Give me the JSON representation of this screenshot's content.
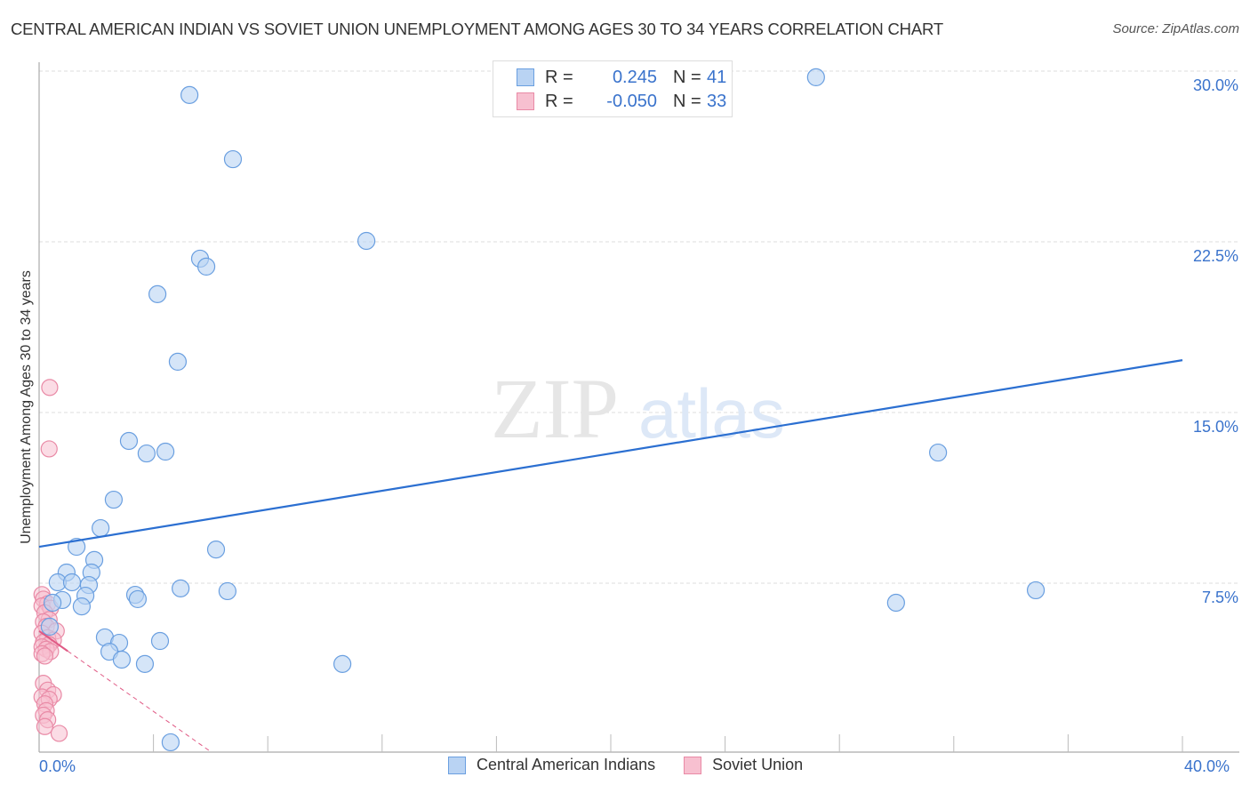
{
  "title": "CENTRAL AMERICAN INDIAN VS SOVIET UNION UNEMPLOYMENT AMONG AGES 30 TO 34 YEARS CORRELATION CHART",
  "source": "Source: ZipAtlas.com",
  "watermark": {
    "zip": "ZIP",
    "atlas": "atlas"
  },
  "colors": {
    "blue_fill": "#b9d3f3",
    "blue_stroke": "#6a9fe0",
    "blue_line": "#2b6fd1",
    "pink_fill": "#f7c0d0",
    "pink_stroke": "#e98aa6",
    "pink_line": "#e05a85",
    "tick_label": "#3a73cc"
  },
  "legend": {
    "rows": [
      {
        "r_label": "R =",
        "r_value": "0.245",
        "n_label": "N =",
        "n_value": "41"
      },
      {
        "r_label": "R =",
        "r_value": "-0.050",
        "n_label": "N =",
        "n_value": "33"
      }
    ]
  },
  "chart_data": {
    "type": "scatter",
    "title": "CENTRAL AMERICAN INDIAN VS SOVIET UNION UNEMPLOYMENT AMONG AGES 30 TO 34 YEARS CORRELATION CHART",
    "xlabel": "",
    "ylabel": "Unemployment Among Ages 30 to 34 years",
    "xlim": [
      0,
      40
    ],
    "ylim": [
      0,
      30.5
    ],
    "x_tick_labels": [
      {
        "value": 0,
        "label": "0.0%"
      },
      {
        "value": 40,
        "label": "40.0%"
      }
    ],
    "y_ticks": [
      {
        "value": 7.5,
        "label": "7.5%"
      },
      {
        "value": 15,
        "label": "15.0%"
      },
      {
        "value": 22.5,
        "label": "22.5%"
      },
      {
        "value": 30,
        "label": "30.0%"
      }
    ],
    "grid": "horizontal dashed",
    "legend_position": "top-center",
    "series": [
      {
        "name": "Central American Indians",
        "r": 0.245,
        "n": 41,
        "trend": {
          "x": [
            0,
            40
          ],
          "y": [
            9.1,
            17.3
          ]
        },
        "points": [
          [
            5.26,
            28.95
          ],
          [
            27.18,
            29.73
          ],
          [
            6.78,
            26.13
          ],
          [
            11.45,
            22.54
          ],
          [
            5.63,
            21.76
          ],
          [
            5.85,
            21.41
          ],
          [
            4.14,
            20.2
          ],
          [
            4.85,
            17.23
          ],
          [
            3.14,
            13.75
          ],
          [
            4.42,
            13.28
          ],
          [
            3.76,
            13.2
          ],
          [
            31.45,
            13.24
          ],
          [
            2.61,
            11.17
          ],
          [
            2.15,
            9.92
          ],
          [
            1.31,
            9.1
          ],
          [
            6.19,
            8.98
          ],
          [
            1.93,
            8.52
          ],
          [
            0.96,
            7.97
          ],
          [
            1.83,
            7.97
          ],
          [
            0.65,
            7.54
          ],
          [
            1.15,
            7.54
          ],
          [
            1.74,
            7.42
          ],
          [
            4.95,
            7.27
          ],
          [
            6.59,
            7.15
          ],
          [
            3.36,
            6.99
          ],
          [
            3.45,
            6.8
          ],
          [
            34.87,
            7.19
          ],
          [
            1.62,
            6.95
          ],
          [
            0.81,
            6.76
          ],
          [
            1.49,
            6.48
          ],
          [
            0.47,
            6.64
          ],
          [
            29.98,
            6.64
          ],
          [
            0.37,
            5.59
          ],
          [
            2.3,
            5.12
          ],
          [
            2.8,
            4.88
          ],
          [
            4.23,
            4.96
          ],
          [
            2.46,
            4.49
          ],
          [
            2.89,
            4.14
          ],
          [
            3.7,
            3.95
          ],
          [
            10.61,
            3.95
          ],
          [
            4.6,
            0.51
          ]
        ]
      },
      {
        "name": "Soviet Union",
        "r": -0.05,
        "n": 33,
        "trend": {
          "x": [
            0,
            6
          ],
          "y": [
            5.4,
            0.1
          ]
        },
        "points": [
          [
            0.37,
            16.1
          ],
          [
            0.35,
            13.4
          ],
          [
            0.1,
            7.0
          ],
          [
            0.15,
            6.8
          ],
          [
            0.3,
            6.6
          ],
          [
            0.1,
            6.5
          ],
          [
            0.4,
            6.4
          ],
          [
            0.2,
            6.2
          ],
          [
            0.35,
            5.9
          ],
          [
            0.15,
            5.8
          ],
          [
            0.25,
            5.6
          ],
          [
            0.6,
            5.4
          ],
          [
            0.1,
            5.3
          ],
          [
            0.3,
            5.1
          ],
          [
            0.5,
            5.0
          ],
          [
            0.15,
            4.9
          ],
          [
            0.35,
            4.8
          ],
          [
            0.1,
            4.7
          ],
          [
            0.25,
            4.6
          ],
          [
            0.4,
            4.5
          ],
          [
            0.1,
            4.4
          ],
          [
            0.2,
            4.3
          ],
          [
            0.15,
            3.1
          ],
          [
            0.3,
            2.8
          ],
          [
            0.5,
            2.6
          ],
          [
            0.1,
            2.5
          ],
          [
            0.35,
            2.4
          ],
          [
            0.2,
            2.2
          ],
          [
            0.25,
            1.9
          ],
          [
            0.15,
            1.7
          ],
          [
            0.3,
            1.5
          ],
          [
            0.2,
            1.2
          ],
          [
            0.7,
            0.9
          ]
        ]
      }
    ]
  }
}
